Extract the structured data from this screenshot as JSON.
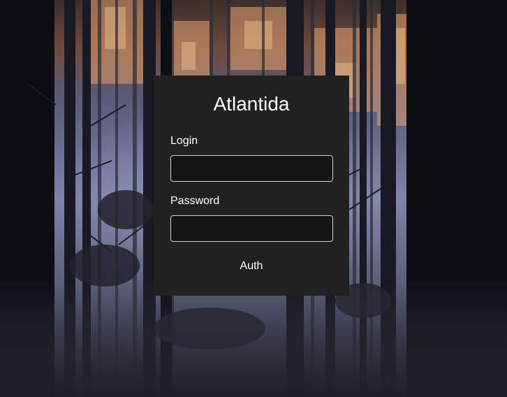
{
  "background": {
    "scene": "misty forest at dusk",
    "colors": {
      "sky_glow": "#d89a6a",
      "mist": "#8a8fb0",
      "trunk": "#0f1016",
      "ground": "#2a2b36"
    }
  },
  "card": {
    "title": "Atlantida",
    "background_color": "#212121",
    "login": {
      "label": "Login",
      "value": "",
      "placeholder": ""
    },
    "password": {
      "label": "Password",
      "value": "",
      "placeholder": ""
    },
    "submit_label": "Auth"
  }
}
